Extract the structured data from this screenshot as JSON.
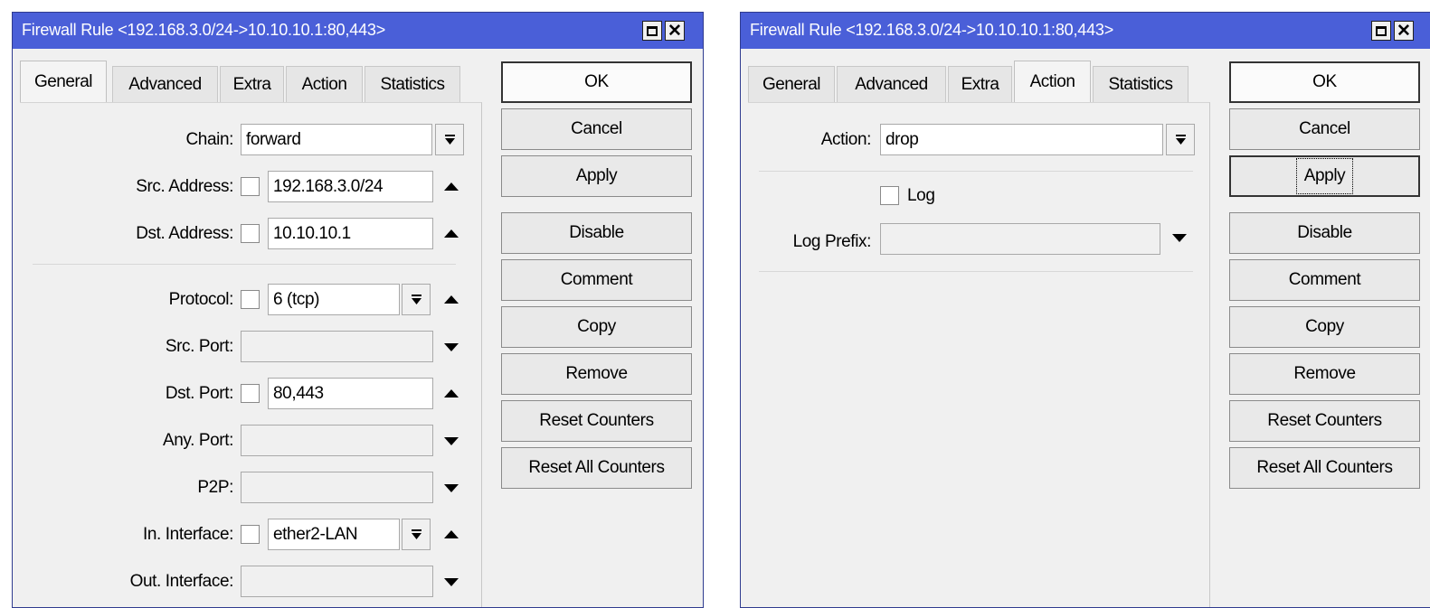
{
  "window_a": {
    "title": "Firewall Rule <192.168.3.0/24->10.10.10.1:80,443>",
    "tabs": [
      {
        "label": "General",
        "active": true
      },
      {
        "label": "Advanced",
        "active": false
      },
      {
        "label": "Extra",
        "active": false
      },
      {
        "label": "Action",
        "active": false
      },
      {
        "label": "Statistics",
        "active": false
      }
    ],
    "fields": {
      "chain": {
        "label": "Chain:",
        "value": "forward"
      },
      "src_address": {
        "label": "Src. Address:",
        "value": "192.168.3.0/24"
      },
      "dst_address": {
        "label": "Dst. Address:",
        "value": "10.10.10.1"
      },
      "protocol": {
        "label": "Protocol:",
        "value": "6 (tcp)"
      },
      "src_port": {
        "label": "Src. Port:",
        "value": ""
      },
      "dst_port": {
        "label": "Dst. Port:",
        "value": "80,443"
      },
      "any_port": {
        "label": "Any. Port:",
        "value": ""
      },
      "p2p": {
        "label": "P2P:",
        "value": ""
      },
      "in_interface": {
        "label": "In. Interface:",
        "value": "ether2-LAN"
      },
      "out_interface": {
        "label": "Out. Interface:",
        "value": ""
      }
    },
    "buttons": {
      "ok": "OK",
      "cancel": "Cancel",
      "apply": "Apply",
      "disable": "Disable",
      "comment": "Comment",
      "copy": "Copy",
      "remove": "Remove",
      "reset_counters": "Reset Counters",
      "reset_all_counters": "Reset All Counters"
    }
  },
  "window_b": {
    "title": "Firewall Rule <192.168.3.0/24->10.10.10.1:80,443>",
    "tabs": [
      {
        "label": "General",
        "active": false
      },
      {
        "label": "Advanced",
        "active": false
      },
      {
        "label": "Extra",
        "active": false
      },
      {
        "label": "Action",
        "active": true
      },
      {
        "label": "Statistics",
        "active": false
      }
    ],
    "fields": {
      "action": {
        "label": "Action:",
        "value": "drop"
      },
      "log": {
        "label": "Log",
        "checked": false
      },
      "log_prefix": {
        "label": "Log Prefix:",
        "value": ""
      }
    },
    "buttons": {
      "ok": "OK",
      "cancel": "Cancel",
      "apply": "Apply",
      "disable": "Disable",
      "comment": "Comment",
      "copy": "Copy",
      "remove": "Remove",
      "reset_counters": "Reset Counters",
      "reset_all_counters": "Reset All Counters"
    }
  },
  "icons": {
    "maximize": "maximize-icon",
    "close": "close-icon",
    "dropdown": "dropdown-icon",
    "collapse": "collapse-arrow-icon",
    "expand": "expand-arrow-icon"
  }
}
